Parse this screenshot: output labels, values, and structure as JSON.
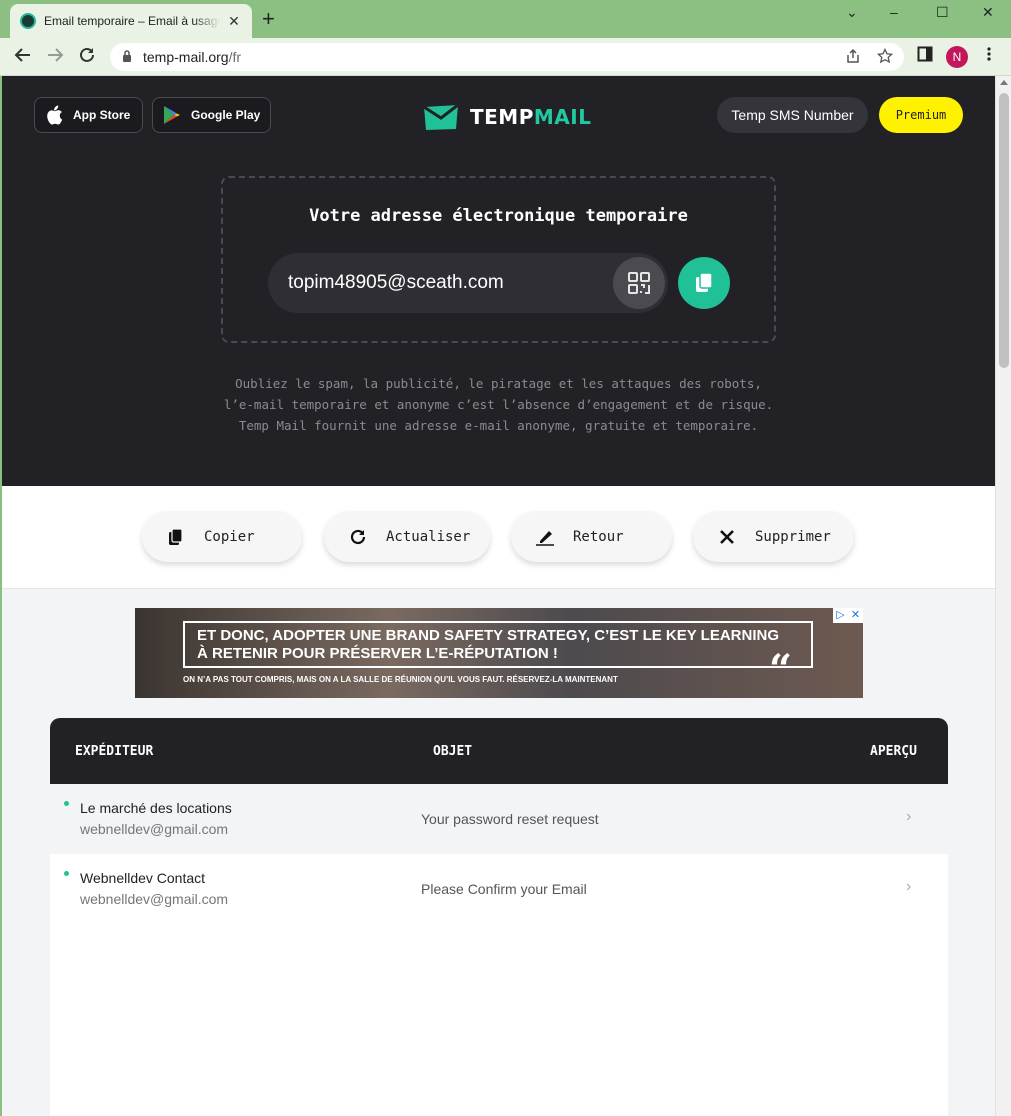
{
  "browser": {
    "tab_title": "Email temporaire – Email à usage unique",
    "tab_close": "✕",
    "new_tab": "+",
    "url_host": "temp-mail.org",
    "url_path": "/fr",
    "profile_initial": "N",
    "window_controls": {
      "minimize": "‒",
      "maximize": "☐",
      "close": "✕",
      "dropdown": "⌄"
    },
    "accent": "#8cc083"
  },
  "header": {
    "app_store": "App Store",
    "google_play": "Google Play",
    "logo_part1": "TEMP",
    "logo_part2": "MAIL",
    "sms_button": "Temp SMS Number",
    "premium_button": "Premium"
  },
  "address": {
    "title": "Votre adresse électronique temporaire",
    "email": "topim48905@sceath.com"
  },
  "description": "Oubliez le spam, la publicité, le piratage et les attaques des robots, l’e-mail temporaire et anonyme c’est l’absence d’engagement et de risque. Temp Mail fournit une adresse e-mail anonyme, gratuite et temporaire.",
  "actions": {
    "copy": "Copier",
    "refresh": "Actualiser",
    "change": "Retour",
    "delete": "Supprimer"
  },
  "ad": {
    "headline_1": "ET DONC, ADOPTER UNE BRAND SAFETY STRATEGY, C’EST LE KEY LEARNING",
    "headline_2": "À RETENIR POUR PRÉSERVER L’E-RÉPUTATION !",
    "sub": "ON N’A PAS TOUT COMPRIS, MAIS ON A LA SALLE DE RÉUNION QU’IL VOUS FAUT.",
    "sub_bold": "RÉSERVEZ-LA MAINTENANT"
  },
  "inbox": {
    "col_sender": "EXPÉDITEUR",
    "col_subject": "OBJET",
    "col_preview": "APERÇU",
    "messages": [
      {
        "sender": "Le marché des locations",
        "from": "webnelldev@gmail.com",
        "subject": "Your password reset request"
      },
      {
        "sender": "Webnelldev Contact",
        "from": "webnelldev@gmail.com",
        "subject": "Please Confirm your Email"
      }
    ]
  },
  "colors": {
    "brand_green": "#20c197",
    "hero_bg": "#212126",
    "premium_yellow": "#fff200"
  }
}
